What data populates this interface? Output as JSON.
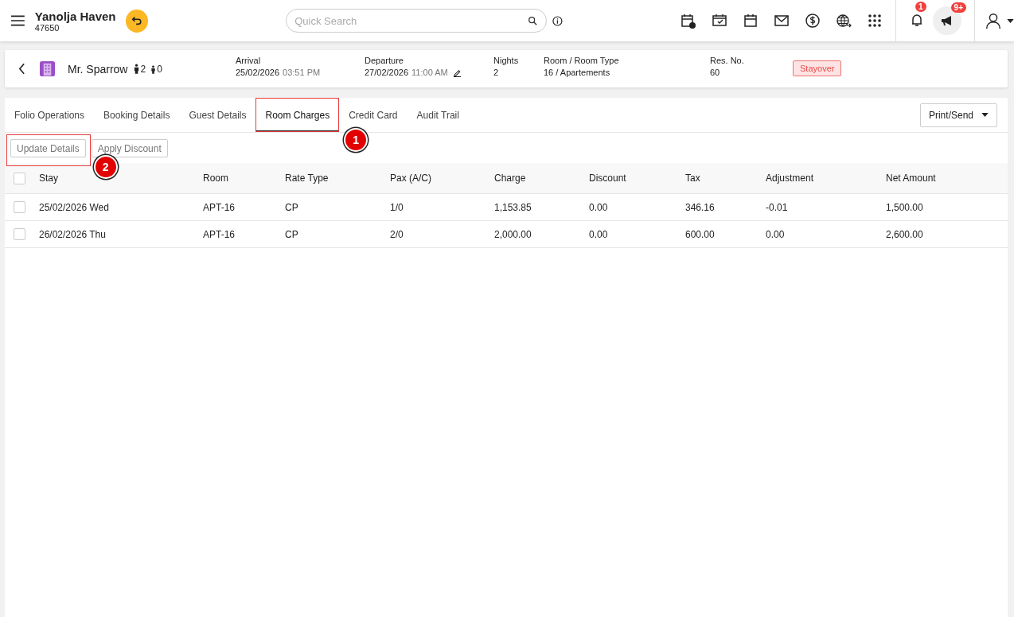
{
  "header": {
    "hotel_name": "Yanolja Haven",
    "hotel_code": "47650",
    "search": {
      "placeholder": "Quick Search"
    },
    "notification_count": "1",
    "announcement_count": "9+"
  },
  "reservation": {
    "guest_name": "Mr. Sparrow",
    "adults": "2",
    "children": "0",
    "fields": [
      {
        "label": "Arrival",
        "value": "25/02/2026",
        "time": "03:51 PM",
        "editable": false
      },
      {
        "label": "Departure",
        "value": "27/02/2026",
        "time": "11:00 AM",
        "editable": true
      },
      {
        "label": "Nights",
        "value": "2",
        "editable": false
      },
      {
        "label": "Room / Room Type",
        "value": "16 / Apartements",
        "editable": false
      },
      {
        "label": "Res. No.",
        "value": "60",
        "editable": false
      }
    ],
    "status": "Stayover"
  },
  "tabs": [
    {
      "label": "Folio Operations",
      "selected": false
    },
    {
      "label": "Booking Details",
      "selected": false
    },
    {
      "label": "Guest Details",
      "selected": false
    },
    {
      "label": "Room Charges",
      "selected": true,
      "callout": "1"
    },
    {
      "label": "Credit Card",
      "selected": false
    },
    {
      "label": "Audit Trail",
      "selected": false
    }
  ],
  "print_button": "Print/Send",
  "actions": [
    {
      "label": "Update Details",
      "callout": "2"
    },
    {
      "label": "Apply Discount"
    }
  ],
  "table": {
    "all_checked": false,
    "columns": [
      "Stay",
      "Room",
      "Rate Type",
      "Pax (A/C)",
      "Charge",
      "Discount",
      "Tax",
      "Adjustment",
      "Net Amount"
    ],
    "rows": [
      {
        "checked": false,
        "cells": [
          "25/02/2026 Wed",
          "APT-16",
          "CP",
          "1/0",
          "1,153.85",
          "0.00",
          "346.16",
          "-0.01",
          "1,500.00"
        ]
      },
      {
        "checked": false,
        "cells": [
          "26/02/2026 Thu",
          "APT-16",
          "CP",
          "2/0",
          "2,000.00",
          "0.00",
          "600.00",
          "0.00",
          "2,600.00"
        ]
      }
    ]
  }
}
